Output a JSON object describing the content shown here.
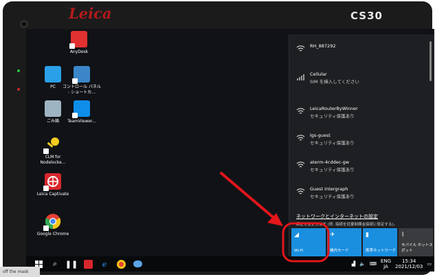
{
  "device": {
    "brand": "Leica",
    "model": "CS30"
  },
  "desktop_icons": [
    {
      "id": "anydesk",
      "label": "AnyDesk",
      "color": "#e23131",
      "glyph": "◆"
    },
    {
      "id": "pc",
      "label": "PC",
      "color": "#2aa0e8",
      "glyph": "▭"
    },
    {
      "id": "control-panel",
      "label": "コントロール パネル - ショートカ...",
      "color": "#3b86c9",
      "glyph": "▦"
    },
    {
      "id": "recycle-bin",
      "label": "ごみ箱",
      "color": "#9fb4c2",
      "glyph": "🗑"
    },
    {
      "id": "teamviewer",
      "label": "TeamViewer...",
      "color": "#0e8ee9",
      "glyph": "⇄"
    },
    {
      "id": "clm",
      "label": "CLM for Nodelocke...",
      "color": "#f2cc20",
      "glyph": "⚷"
    },
    {
      "id": "captivate",
      "label": "Leica Captivate",
      "color": "#d7262c",
      "glyph": "◎"
    },
    {
      "id": "chrome",
      "label": "Google Chrome",
      "color": "#e9e9e9",
      "glyph": "●"
    }
  ],
  "network_panel": {
    "networks": [
      {
        "name": "RH_887292",
        "status": "",
        "icon": "wifi-connected-icon"
      },
      {
        "name": "Cellular",
        "status": "SIM を挿入してください",
        "icon": "cellular-icon"
      },
      {
        "name": "LeicaRouterByWinner",
        "status": "セキュリティ保護あり",
        "icon": "wifi-secured-icon"
      },
      {
        "name": "lgs-guest",
        "status": "セキュリティ保護あり",
        "icon": "wifi-secured-icon"
      },
      {
        "name": "aterm-4cddec-gw",
        "status": "セキュリティ保護あり",
        "icon": "wifi-secured-icon"
      },
      {
        "name": "Guest Intergraph",
        "status": "セキュリティ保護あり",
        "icon": "wifi-secured-icon"
      }
    ],
    "settings_link": "ネットワークとインターネットの設定",
    "settings_desc": "設定を変更します (例: 接続を従量制課金接続に設定する)。",
    "tiles": [
      {
        "label": "Wi-Fi",
        "active": true
      },
      {
        "label": "機内モード",
        "active": true
      },
      {
        "label": "携帯ネットワーク",
        "active": true
      },
      {
        "label": "モバイル ホットスポット",
        "active": false
      }
    ]
  },
  "taskbar": {
    "lang1": "ENG",
    "lang2": "JA",
    "time": "15:34",
    "date": "2021/12/03"
  },
  "overlay": {
    "watermark": "off the mask",
    "highlight_color": "#e3161b"
  },
  "colors": {
    "accent": "#1a8fe0",
    "screen_bg": "#101216",
    "panel_bg": "#1e1f22"
  }
}
